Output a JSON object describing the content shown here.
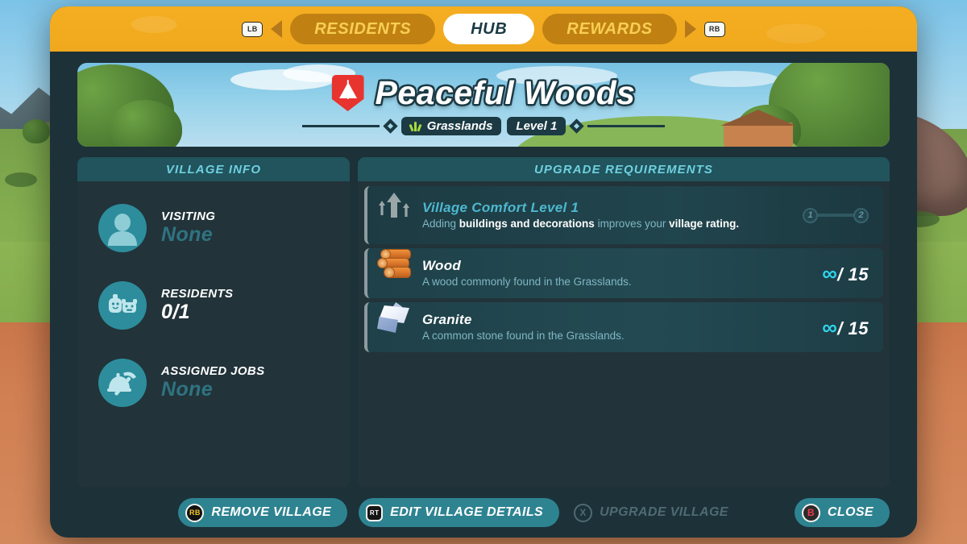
{
  "window": {
    "background_scene": "grassland-with-dirt-path"
  },
  "tabbar": {
    "left_bumper": "LB",
    "right_bumper": "RB",
    "left_arrow_icon": "triangle-left-icon",
    "right_arrow_icon": "triangle-right-icon",
    "tabs": [
      {
        "label": "RESIDENTS",
        "active": false
      },
      {
        "label": "HUB",
        "active": true
      },
      {
        "label": "REWARDS",
        "active": false
      }
    ]
  },
  "banner": {
    "crest_icon": "tent-shield-icon",
    "title": "Peaceful Woods",
    "biome_icon": "grass-icon",
    "biome": "Grasslands",
    "level": "Level 1"
  },
  "village_info": {
    "header": "VILLAGE INFO",
    "rows": [
      {
        "icon": "visitor-avatar-icon",
        "label": "VISITING",
        "value": "None",
        "muted": true
      },
      {
        "icon": "residents-icon",
        "label": "RESIDENTS",
        "value": "0/1",
        "muted": false
      },
      {
        "icon": "jobs-pickaxe-icon",
        "label": "ASSIGNED JOBS",
        "value": "None",
        "muted": true
      }
    ]
  },
  "upgrade_requirements": {
    "header": "UPGRADE REQUIREMENTS",
    "comfort": {
      "icon": "three-up-arrows-icon",
      "title": "Village Comfort Level 1",
      "desc_part1": "Adding ",
      "desc_bold1": "buildings and decorations",
      "desc_part2": " improves your ",
      "desc_bold2": "village rating.",
      "stepper_from": "1",
      "stepper_to": "2"
    },
    "resources": [
      {
        "icon": "wood-logs-icon",
        "name": "Wood",
        "desc": "A wood commonly found in the Grasslands.",
        "owned": "∞",
        "separator": "/",
        "required": "15"
      },
      {
        "icon": "granite-block-icon",
        "name": "Granite",
        "desc": "A common stone found in the Grasslands.",
        "owned": "∞",
        "separator": "/",
        "required": "15"
      }
    ]
  },
  "footer": {
    "buttons": [
      {
        "glyph": "RB",
        "glyph_icon": "xbox-rb-button-icon",
        "label": "REMOVE VILLAGE",
        "state": "enabled"
      },
      {
        "glyph": "RT",
        "glyph_icon": "xbox-rt-trigger-icon",
        "label": "EDIT VILLAGE DETAILS",
        "state": "enabled"
      },
      {
        "glyph": "X",
        "glyph_icon": "xbox-x-button-icon",
        "label": "UPGRADE VILLAGE",
        "state": "disabled"
      },
      {
        "glyph": "B",
        "glyph_icon": "xbox-b-button-icon",
        "label": "CLOSE",
        "state": "enabled"
      }
    ]
  },
  "colors": {
    "tabbar_orange": "#f2a91f",
    "tab_inactive": "#c08112",
    "tab_text_yellow": "#f8cf52",
    "panel_dark": "#1d3138",
    "panel_body": "#22333a",
    "panel_header": "#21545d",
    "accent_cyan": "#4db8cf",
    "teal_button": "#2e8391",
    "icon_circle": "#2d8d9c",
    "muted_value": "#2f7380",
    "infinity_cyan": "#2ed3ee"
  }
}
